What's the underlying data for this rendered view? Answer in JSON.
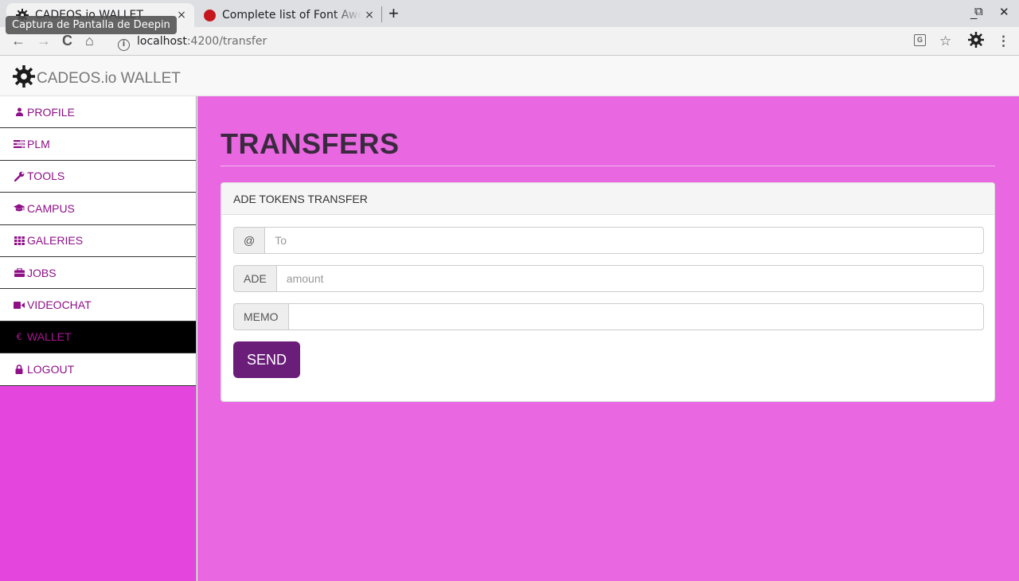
{
  "browser": {
    "tabs": [
      {
        "title": "CADEOS.io WALLET",
        "close": "×",
        "active": true
      },
      {
        "title": "Complete list of Font Awesome",
        "close": "×",
        "active": false
      }
    ],
    "new_tab": "+",
    "tooltip": "Captura de Pantalla de Deepin",
    "window_controls": {
      "minimize": "_",
      "restore": "⧉",
      "close": "✕"
    },
    "nav": {
      "back": "←",
      "forward": "→",
      "reload": "C",
      "home": "⌂"
    },
    "address": {
      "host": "localhost",
      "path": ":4200/transfer",
      "info_glyph": "i"
    },
    "toolbar_icons": {
      "translate": "G",
      "bookmark": "☆",
      "menu": "⋮"
    }
  },
  "app": {
    "brand": "CADEOS.io WALLET"
  },
  "sidebar": {
    "items": [
      {
        "label": "PROFILE",
        "icon": "user-icon"
      },
      {
        "label": "PLM",
        "icon": "tasks-icon"
      },
      {
        "label": "TOOLS",
        "icon": "wrench-icon"
      },
      {
        "label": "CAMPUS",
        "icon": "graduation-cap-icon"
      },
      {
        "label": "GALERIES",
        "icon": "th-icon"
      },
      {
        "label": "JOBS",
        "icon": "briefcase-icon"
      },
      {
        "label": "VIDEOCHAT",
        "icon": "video-camera-icon"
      },
      {
        "label": "WALLET",
        "icon": "euro-icon",
        "active": true
      },
      {
        "label": "LOGOUT",
        "icon": "lock-icon"
      }
    ]
  },
  "main": {
    "title": "TRANSFERS",
    "panel": {
      "heading": "ADE TOKENS TRANSFER",
      "to": {
        "addon": "@",
        "placeholder": "To",
        "value": ""
      },
      "amount": {
        "addon": "ADE",
        "placeholder": "amount",
        "value": ""
      },
      "memo": {
        "addon": "MEMO",
        "placeholder": "",
        "value": ""
      },
      "send_label": "SEND"
    }
  },
  "colors": {
    "sidebar_bg": "#e445dd",
    "main_bg": "#e968e1",
    "nav_text": "#8e0f88",
    "active_nav_bg": "#000000",
    "send_button": "#6a1e7a"
  }
}
